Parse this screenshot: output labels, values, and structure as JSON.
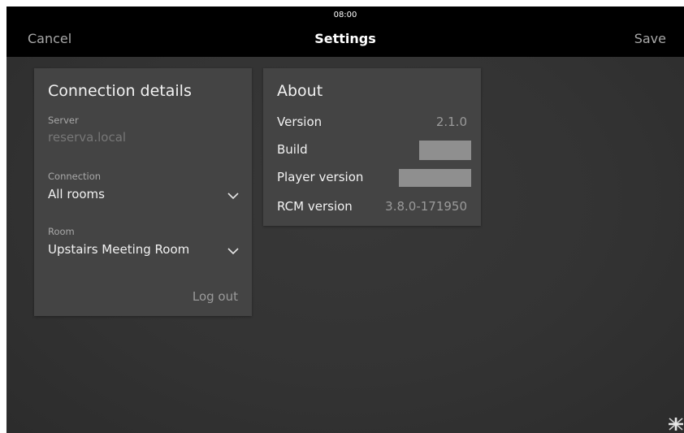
{
  "statusbar": {
    "time": "08:00"
  },
  "navbar": {
    "cancel_label": "Cancel",
    "title": "Settings",
    "save_label": "Save"
  },
  "connection_card": {
    "title": "Connection details",
    "server_label": "Server",
    "server_value": "reserva.local",
    "connection_label": "Connection",
    "connection_value": "All rooms",
    "room_label": "Room",
    "room_value": "Upstairs Meeting Room",
    "logout_label": "Log out"
  },
  "about_card": {
    "title": "About",
    "rows": [
      {
        "label": "Version",
        "value": "2.1.0"
      },
      {
        "label": "Build",
        "value": ""
      },
      {
        "label": "Player version",
        "value": ""
      },
      {
        "label": "RCM version",
        "value": "3.8.0-171950"
      }
    ]
  },
  "icons": {
    "chevron": "chevron-down-icon",
    "language": "uk-flag-icon"
  },
  "colors": {
    "background": "#333333",
    "bar": "#000000",
    "card": "#444444",
    "text": "#f2f2f2",
    "muted": "#a8a8a8"
  }
}
